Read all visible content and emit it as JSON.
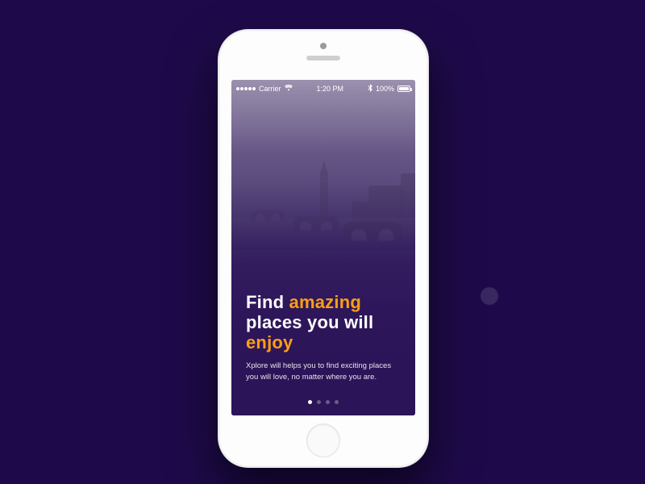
{
  "status_bar": {
    "carrier": "Carrier",
    "wifi_icon": "wifi",
    "time": "1:20 PM",
    "bluetooth_icon": "bluetooth",
    "battery_percent": "100%"
  },
  "onboarding": {
    "heading": {
      "part1": "Find ",
      "accent1": "amazing",
      "part2": " places you will ",
      "accent2": "enjoy"
    },
    "subtitle": "Xplore will helps you to find exciting places you will love, no matter where you are.",
    "page_count": 4,
    "active_page_index": 0
  },
  "colors": {
    "background": "#1e0a4a",
    "accent": "#ff9e16",
    "screen_gradient_bottom": "#2c1458"
  }
}
